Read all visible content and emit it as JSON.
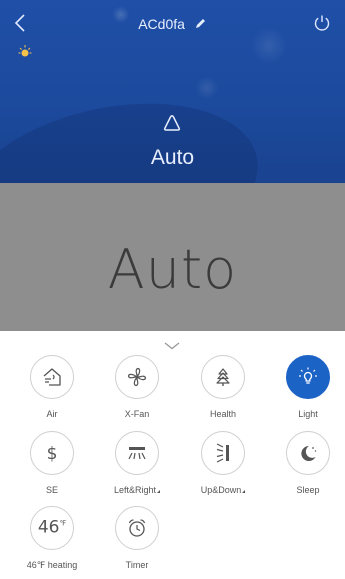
{
  "header": {
    "device_name": "ACd0fa",
    "back_icon": "chevron-left-icon",
    "edit_icon": "pencil-icon",
    "power_icon": "power-icon",
    "light_indicator_icon": "bulb-icon"
  },
  "mode": {
    "icon": "auto-mode-icon",
    "label": "Auto",
    "display_text": "Auto"
  },
  "colors": {
    "header_blue": "#1f4fa7",
    "display_gray": "#8e8e8e",
    "active_blue": "#1c63c6"
  },
  "controls": {
    "collapse_icon": "chevron-down-icon",
    "buttons": [
      {
        "label": "Air",
        "icon": "air-icon",
        "active": false
      },
      {
        "label": "X-Fan",
        "icon": "fan-icon",
        "active": false
      },
      {
        "label": "Health",
        "icon": "tree-icon",
        "active": false
      },
      {
        "label": "Light",
        "icon": "light-bulb-icon",
        "active": true
      },
      {
        "label": "SE",
        "icon": "dollar-icon",
        "active": false
      },
      {
        "label": "Left&Right",
        "icon": "swing-horizontal-icon",
        "active": false
      },
      {
        "label": "Up&Down",
        "icon": "swing-vertical-icon",
        "active": false
      },
      {
        "label": "Sleep",
        "icon": "moon-icon",
        "active": false
      },
      {
        "label": "46℉ heating",
        "icon": "46f-icon",
        "value": "46",
        "unit": "℉",
        "active": false
      },
      {
        "label": "Timer",
        "icon": "alarm-clock-icon",
        "active": false
      }
    ]
  }
}
